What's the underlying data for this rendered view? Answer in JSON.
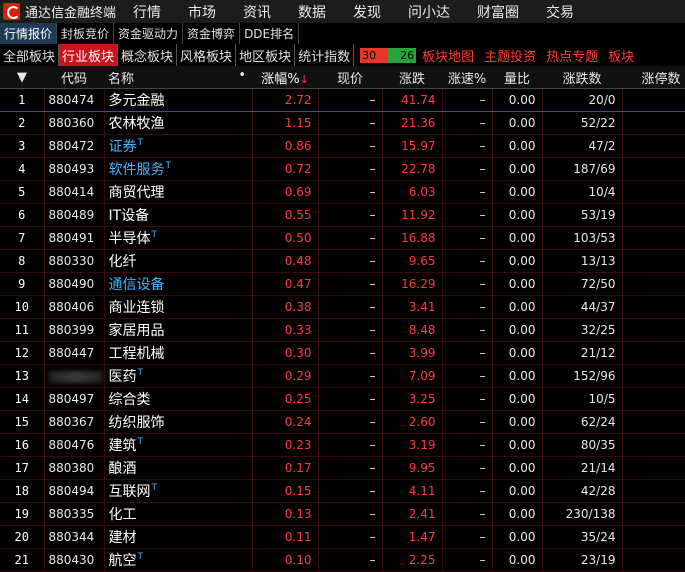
{
  "app": {
    "title": "通达信金融终端"
  },
  "menu": [
    "行情",
    "市场",
    "资讯",
    "数据",
    "发现",
    "问小达",
    "财富圈",
    "交易"
  ],
  "tabs_primary": [
    "行情报价",
    "封板竞价",
    "资金驱动力",
    "资金博弈",
    "DDE排名"
  ],
  "tabs_secondary": [
    "全部板块",
    "行业板块",
    "概念板块",
    "风格板块",
    "地区板块",
    "统计指数"
  ],
  "updown": {
    "up": "30",
    "down": "26"
  },
  "red_links": [
    "板块地图",
    "主题投资",
    "热点专题",
    "板块"
  ],
  "colors": {
    "up": "#ff3a3a",
    "blue_name": "#3fb6ff",
    "active_tab": "#c8141e"
  },
  "table": {
    "headers": [
      "代码",
      "名称",
      "涨幅%",
      "现价",
      "涨跌",
      "涨速%",
      "量比",
      "涨跌数",
      "涨停数"
    ],
    "rows": [
      {
        "idx": "1",
        "code": "880474",
        "name": "多元金融",
        "sup": "",
        "blue": false,
        "pct": "2.72",
        "price": "–",
        "chg": "41.74",
        "speed": "–",
        "vr": "0.00",
        "updn": "20/0"
      },
      {
        "idx": "2",
        "code": "880360",
        "name": "农林牧渔",
        "sup": "",
        "blue": false,
        "pct": "1.15",
        "price": "–",
        "chg": "21.36",
        "speed": "–",
        "vr": "0.00",
        "updn": "52/22"
      },
      {
        "idx": "3",
        "code": "880472",
        "name": "证券",
        "sup": "T",
        "blue": true,
        "pct": "0.86",
        "price": "–",
        "chg": "15.97",
        "speed": "–",
        "vr": "0.00",
        "updn": "47/2"
      },
      {
        "idx": "4",
        "code": "880493",
        "name": "软件服务",
        "sup": "T",
        "blue": true,
        "pct": "0.72",
        "price": "–",
        "chg": "22.78",
        "speed": "–",
        "vr": "0.00",
        "updn": "187/69"
      },
      {
        "idx": "5",
        "code": "880414",
        "name": "商贸代理",
        "sup": "",
        "blue": false,
        "pct": "0.69",
        "price": "–",
        "chg": "6.03",
        "speed": "–",
        "vr": "0.00",
        "updn": "10/4"
      },
      {
        "idx": "6",
        "code": "880489",
        "name": "IT设备",
        "sup": "",
        "blue": false,
        "pct": "0.55",
        "price": "–",
        "chg": "11.92",
        "speed": "–",
        "vr": "0.00",
        "updn": "53/19"
      },
      {
        "idx": "7",
        "code": "880491",
        "name": "半导体",
        "sup": "T",
        "blue": false,
        "pct": "0.50",
        "price": "–",
        "chg": "16.88",
        "speed": "–",
        "vr": "0.00",
        "updn": "103/53"
      },
      {
        "idx": "8",
        "code": "880330",
        "name": "化纤",
        "sup": "",
        "blue": false,
        "pct": "0.48",
        "price": "–",
        "chg": "9.65",
        "speed": "–",
        "vr": "0.00",
        "updn": "13/13"
      },
      {
        "idx": "9",
        "code": "880490",
        "name": "通信设备",
        "sup": "",
        "blue": true,
        "pct": "0.47",
        "price": "–",
        "chg": "16.29",
        "speed": "–",
        "vr": "0.00",
        "updn": "72/50"
      },
      {
        "idx": "10",
        "code": "880406",
        "name": "商业连锁",
        "sup": "",
        "blue": false,
        "pct": "0.38",
        "price": "–",
        "chg": "3.41",
        "speed": "–",
        "vr": "0.00",
        "updn": "44/37"
      },
      {
        "idx": "11",
        "code": "880399",
        "name": "家居用品",
        "sup": "",
        "blue": false,
        "pct": "0.33",
        "price": "–",
        "chg": "8.48",
        "speed": "–",
        "vr": "0.00",
        "updn": "32/25"
      },
      {
        "idx": "12",
        "code": "880447",
        "name": "工程机械",
        "sup": "",
        "blue": false,
        "pct": "0.30",
        "price": "–",
        "chg": "3.99",
        "speed": "–",
        "vr": "0.00",
        "updn": "21/12"
      },
      {
        "idx": "13",
        "code": "",
        "name": "医药",
        "sup": "T",
        "blue": false,
        "pct": "0.29",
        "price": "–",
        "chg": "7.09",
        "speed": "–",
        "vr": "0.00",
        "updn": "152/96"
      },
      {
        "idx": "14",
        "code": "880497",
        "name": "综合类",
        "sup": "",
        "blue": false,
        "pct": "0.25",
        "price": "–",
        "chg": "3.25",
        "speed": "–",
        "vr": "0.00",
        "updn": "10/5"
      },
      {
        "idx": "15",
        "code": "880367",
        "name": "纺织服饰",
        "sup": "",
        "blue": false,
        "pct": "0.24",
        "price": "–",
        "chg": "2.60",
        "speed": "–",
        "vr": "0.00",
        "updn": "62/24"
      },
      {
        "idx": "16",
        "code": "880476",
        "name": "建筑",
        "sup": "T",
        "blue": false,
        "pct": "0.23",
        "price": "–",
        "chg": "3.19",
        "speed": "–",
        "vr": "0.00",
        "updn": "80/35"
      },
      {
        "idx": "17",
        "code": "880380",
        "name": "酿酒",
        "sup": "",
        "blue": false,
        "pct": "0.17",
        "price": "–",
        "chg": "9.95",
        "speed": "–",
        "vr": "0.00",
        "updn": "21/14"
      },
      {
        "idx": "18",
        "code": "880494",
        "name": "互联网",
        "sup": "T",
        "blue": false,
        "pct": "0.15",
        "price": "–",
        "chg": "4.11",
        "speed": "–",
        "vr": "0.00",
        "updn": "42/28"
      },
      {
        "idx": "19",
        "code": "880335",
        "name": "化工",
        "sup": "",
        "blue": false,
        "pct": "0.13",
        "price": "–",
        "chg": "2.41",
        "speed": "–",
        "vr": "0.00",
        "updn": "230/138"
      },
      {
        "idx": "20",
        "code": "880344",
        "name": "建材",
        "sup": "",
        "blue": false,
        "pct": "0.11",
        "price": "–",
        "chg": "1.47",
        "speed": "–",
        "vr": "0.00",
        "updn": "35/24"
      },
      {
        "idx": "21",
        "code": "880430",
        "name": "航空",
        "sup": "T",
        "blue": false,
        "pct": "0.10",
        "price": "–",
        "chg": "2.25",
        "speed": "–",
        "vr": "0.00",
        "updn": "23/19"
      }
    ]
  }
}
